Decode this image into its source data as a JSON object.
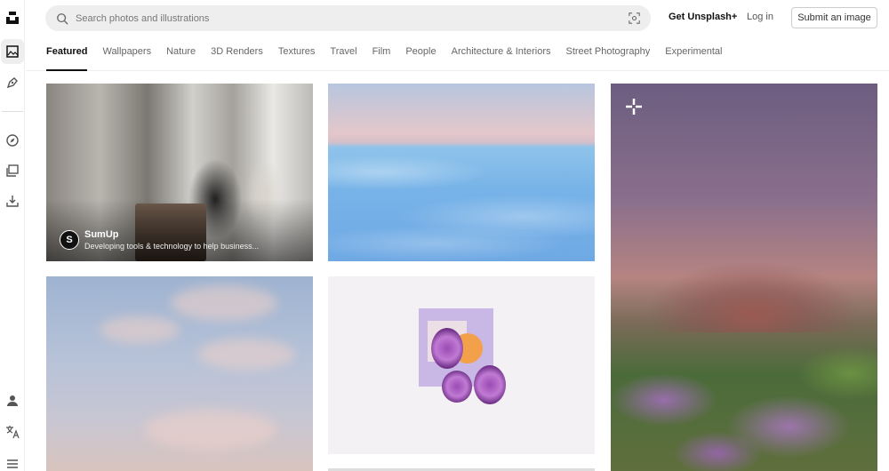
{
  "search": {
    "placeholder": "Search photos and illustrations"
  },
  "header": {
    "get_plus": "Get Unsplash+",
    "login": "Log in",
    "submit": "Submit an image"
  },
  "tabs": [
    {
      "label": "Featured",
      "active": true
    },
    {
      "label": "Wallpapers"
    },
    {
      "label": "Nature"
    },
    {
      "label": "3D Renders"
    },
    {
      "label": "Textures"
    },
    {
      "label": "Travel"
    },
    {
      "label": "Film"
    },
    {
      "label": "People"
    },
    {
      "label": "Architecture & Interiors"
    },
    {
      "label": "Street Photography"
    },
    {
      "label": "Experimental"
    }
  ],
  "rail_icons": [
    "unsplash-logo-icon",
    "image-icon",
    "pen-icon",
    "compass-icon",
    "collections-icon",
    "download-icon",
    "user-icon",
    "translate-icon",
    "menu-icon"
  ],
  "sponsor": {
    "logo": "S",
    "name": "SumUp",
    "description": "Developing tools & technology to help business..."
  }
}
